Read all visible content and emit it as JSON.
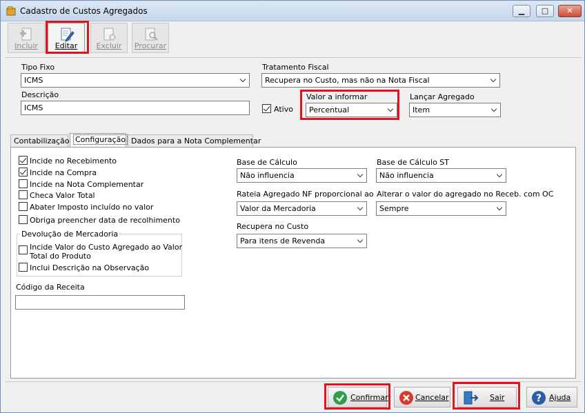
{
  "window": {
    "title": "Cadastro de Custos Agregados"
  },
  "toolbar": {
    "incluir": "Incluir",
    "editar": "Editar",
    "excluir": "Excluir",
    "procurar": "Procurar"
  },
  "header": {
    "tipo_fixo_label": "Tipo Fixo",
    "tipo_fixo_value": "ICMS",
    "descricao_label": "Descrição",
    "descricao_value": "ICMS",
    "tratamento_label": "Tratamento Fiscal",
    "tratamento_value": "Recupera no Custo, mas não na Nota Fiscal",
    "ativo_label": "Ativo",
    "valor_label": "Valor a informar",
    "valor_value": "Percentual",
    "lancar_label": "Lançar Agregado",
    "lancar_value": "Item"
  },
  "tabs": [
    {
      "label": "Contabilização"
    },
    {
      "label": "Configuração"
    },
    {
      "label": "Dados para a Nota Complementar"
    }
  ],
  "config": {
    "checks": [
      {
        "label": "Incide no Recebimento",
        "checked": true
      },
      {
        "label": "Incide na Compra",
        "checked": true
      },
      {
        "label": "Incide na Nota Complementar",
        "checked": false
      },
      {
        "label": "Checa Valor Total",
        "checked": false
      },
      {
        "label": "Abater Imposto incluído no valor",
        "checked": false
      },
      {
        "label": "Obriga preencher data de recolhimento",
        "checked": false
      }
    ],
    "devolucao_title": "Devolução de Mercadoria",
    "devolucao_check1_line1": "Incide Valor do Custo Agregado ao Valor",
    "devolucao_check1_line2": "Total do Produto",
    "devolucao_check2": "Inclui Descrição na Observação",
    "codigo_receita_label": "Código da Receita",
    "codigo_receita_value": "",
    "base_calculo_label": "Base de Cálculo",
    "base_calculo_value": "Não influencia",
    "base_calculo_st_label": "Base de Cálculo ST",
    "base_calculo_st_value": "Não influencia",
    "rateia_label": "Rateia Agregado NF proporcional ao",
    "rateia_value": "Valor da Mercadoria",
    "alterar_label": "Alterar o valor do agregado no Receb. com OC",
    "alterar_value": "Sempre",
    "recupera_label": "Recupera no Custo",
    "recupera_value": "Para itens de Revenda"
  },
  "buttons": {
    "confirmar": "Confirmar",
    "cancelar": "Cancelar",
    "sair": "Sair",
    "ajuda": "Ajuda"
  },
  "icons": {
    "app": "folder-icon",
    "confirm": "check-circle-icon",
    "cancel": "x-circle-icon",
    "exit": "door-exit-icon",
    "help": "question-icon"
  }
}
